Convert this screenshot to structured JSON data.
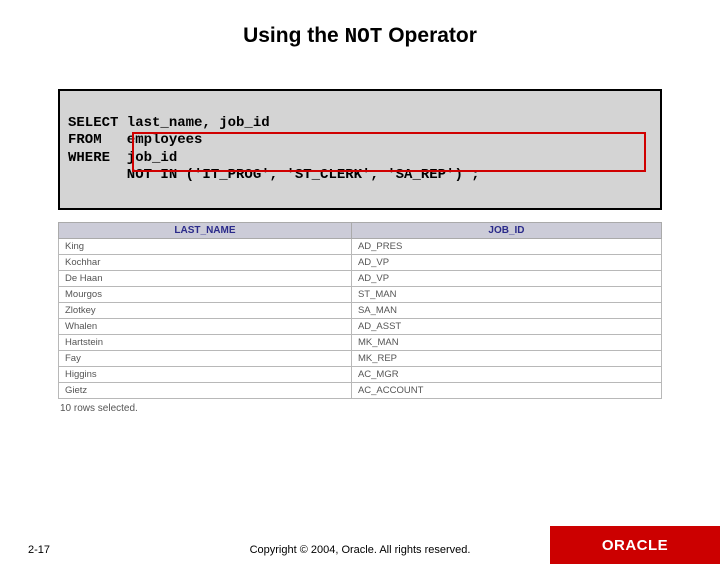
{
  "title": {
    "pre": "Using the ",
    "op": "NOT",
    "post": " Operator"
  },
  "sql": {
    "line1": "SELECT last_name, job_id",
    "line2": "FROM   employees",
    "line3": "WHERE  job_id",
    "line4": "       NOT IN ('IT_PROG', 'ST_CLERK', 'SA_REP') ;"
  },
  "table": {
    "headers": {
      "c1": "LAST_NAME",
      "c2": "JOB_ID"
    },
    "rows": [
      {
        "c1": "King",
        "c2": "AD_PRES"
      },
      {
        "c1": "Kochhar",
        "c2": "AD_VP"
      },
      {
        "c1": "De Haan",
        "c2": "AD_VP"
      },
      {
        "c1": "Mourgos",
        "c2": "ST_MAN"
      },
      {
        "c1": "Zlotkey",
        "c2": "SA_MAN"
      },
      {
        "c1": "Whalen",
        "c2": "AD_ASST"
      },
      {
        "c1": "Hartstein",
        "c2": "MK_MAN"
      },
      {
        "c1": "Fay",
        "c2": "MK_REP"
      },
      {
        "c1": "Higgins",
        "c2": "AC_MGR"
      },
      {
        "c1": "Gietz",
        "c2": "AC_ACCOUNT"
      }
    ],
    "note": "10 rows selected."
  },
  "footer": {
    "page": "2-17",
    "copyright": "Copyright © 2004, Oracle. All rights reserved.",
    "brand": "ORACLE"
  }
}
